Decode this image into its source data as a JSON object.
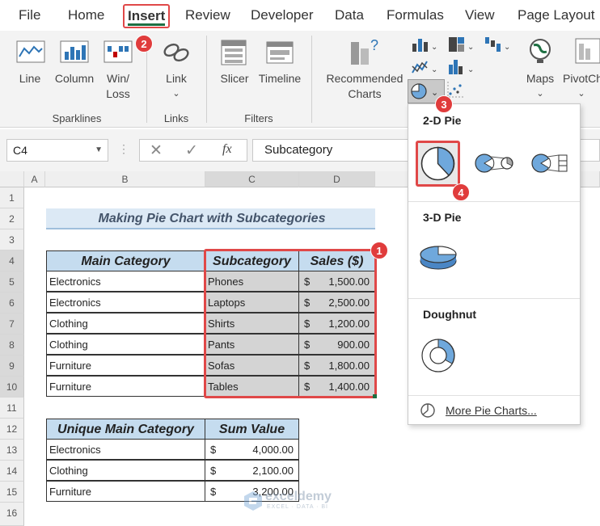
{
  "menu": {
    "file": "File",
    "home": "Home",
    "insert": "Insert",
    "review": "Review",
    "developer": "Developer",
    "data": "Data",
    "formulas": "Formulas",
    "view": "View",
    "page_layout": "Page Layout"
  },
  "ribbon": {
    "sparklines": {
      "line": "Line",
      "column": "Column",
      "winloss_1": "Win/",
      "winloss_2": "Loss",
      "group": "Sparklines"
    },
    "links": {
      "link": "Link",
      "group": "Links"
    },
    "filters": {
      "slicer": "Slicer",
      "timeline": "Timeline",
      "group": "Filters"
    },
    "charts": {
      "recommended_1": "Recommended",
      "recommended_2": "Charts",
      "maps": "Maps",
      "pivotchart": "PivotCh"
    }
  },
  "formula_bar": {
    "name_box": "C4",
    "fx": "fx",
    "value": "Subcategory"
  },
  "columns": [
    "A",
    "B",
    "C",
    "D"
  ],
  "rows": [
    "1",
    "2",
    "3",
    "4",
    "5",
    "6",
    "7",
    "8",
    "9",
    "10",
    "11",
    "12",
    "13",
    "14",
    "15",
    "16"
  ],
  "sheet": {
    "title": "Making Pie Chart with Subcategories",
    "table1": {
      "headers": [
        "Main Category",
        "Subcategory",
        "Sales ($)"
      ],
      "rows": [
        {
          "main": "Electronics",
          "sub": "Phones",
          "cur": "$",
          "sales": "1,500.00"
        },
        {
          "main": "Electronics",
          "sub": "Laptops",
          "cur": "$",
          "sales": "2,500.00"
        },
        {
          "main": "Clothing",
          "sub": "Shirts",
          "cur": "$",
          "sales": "1,200.00"
        },
        {
          "main": "Clothing",
          "sub": "Pants",
          "cur": "$",
          "sales": "900.00"
        },
        {
          "main": "Furniture",
          "sub": "Sofas",
          "cur": "$",
          "sales": "1,800.00"
        },
        {
          "main": "Furniture",
          "sub": "Tables",
          "cur": "$",
          "sales": "1,400.00"
        }
      ]
    },
    "table2": {
      "headers": [
        "Unique Main Category",
        "Sum Value"
      ],
      "rows": [
        {
          "main": "Electronics",
          "cur": "$",
          "sum": "4,000.00"
        },
        {
          "main": "Clothing",
          "cur": "$",
          "sum": "2,100.00"
        },
        {
          "main": "Furniture",
          "cur": "$",
          "sum": "3,200.00"
        }
      ]
    }
  },
  "dropdown": {
    "pie2d": "2-D Pie",
    "pie3d": "3-D Pie",
    "doughnut": "Doughnut",
    "more": "More Pie Charts..."
  },
  "badges": [
    "1",
    "2",
    "3",
    "4"
  ],
  "watermark": {
    "name": "exceldemy",
    "tagline": "EXCEL · DATA · BI"
  },
  "colors": {
    "accent_red": "#e03c3c",
    "header_fill": "#c5dcef",
    "excel_green": "#1d6f42",
    "pie_blue": "#6fa8dc"
  }
}
